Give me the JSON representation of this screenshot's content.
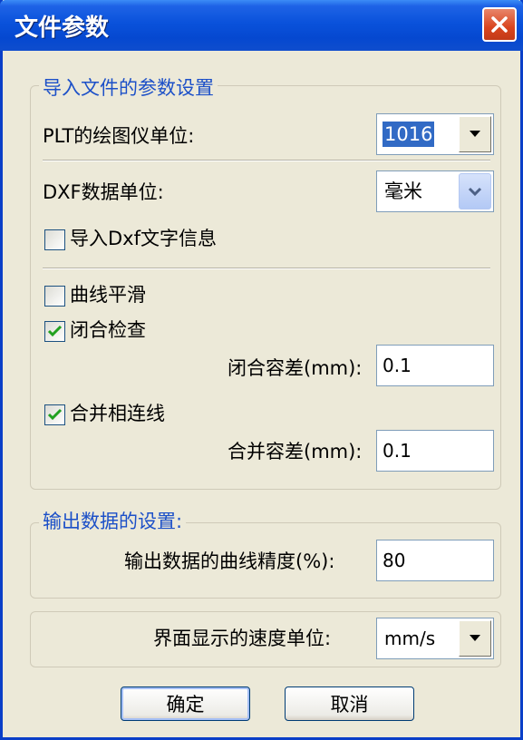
{
  "window": {
    "title": "文件参数"
  },
  "import_group": {
    "legend": "导入文件的参数设置",
    "plt_label": "PLT的绘图仪单位:",
    "plt_value": "1016",
    "dxf_label": "DXF数据单位:",
    "dxf_value": "毫米",
    "import_text_label": "导入Dxf文字信息",
    "import_text_checked": false,
    "smooth_label": "曲线平滑",
    "smooth_checked": false,
    "close_check_label": "闭合检查",
    "close_check_checked": true,
    "close_tol_label": "闭合容差(mm):",
    "close_tol_value": "0.1",
    "merge_label": "合并相连线",
    "merge_checked": true,
    "merge_tol_label": "合并容差(mm):",
    "merge_tol_value": "0.1"
  },
  "output_group": {
    "legend": "输出数据的设置:",
    "precision_label": "输出数据的曲线精度(%):",
    "precision_value": "80"
  },
  "speed_group": {
    "speed_label": "界面显示的速度单位:",
    "speed_value": "mm/s"
  },
  "buttons": {
    "ok": "确定",
    "cancel": "取消"
  },
  "colors": {
    "title_bar": "#0A52DB",
    "legend_text": "#1C50C8",
    "dialog_bg": "#ECE9D8",
    "close_button": "#D9441E"
  },
  "icons": {
    "close": "close-icon",
    "dropdown": "chevron-down-icon",
    "check": "checkmark-icon"
  }
}
